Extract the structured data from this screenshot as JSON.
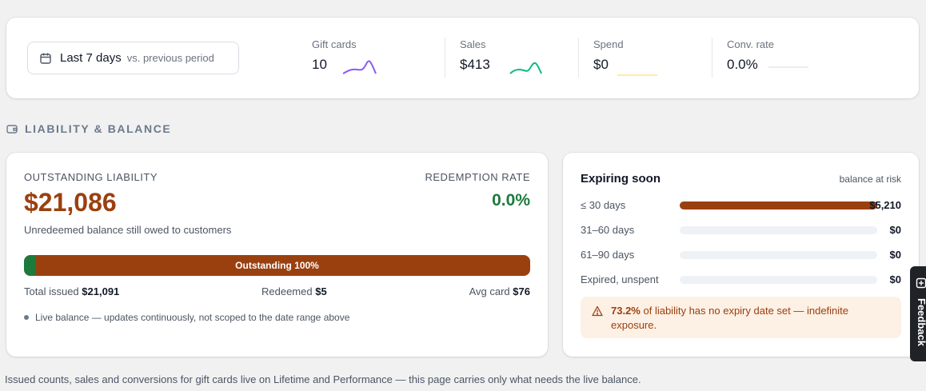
{
  "stats": {
    "date_range": {
      "label": "Last 7 days",
      "comparison": "vs. previous period"
    },
    "metrics": [
      {
        "label": "Gift cards",
        "value": "10",
        "spark_color": "#8b5cf6"
      },
      {
        "label": "Sales",
        "value": "$413",
        "spark_color": "#10b981"
      },
      {
        "label": "Spend",
        "value": "$0",
        "spark_color": "#fbbf24"
      },
      {
        "label": "Conv. rate",
        "value": "0.0%",
        "spark_color": "#d1d5db"
      }
    ]
  },
  "section": {
    "title": "LIABILITY & BALANCE"
  },
  "liability": {
    "label": "OUTSTANDING LIABILITY",
    "amount": "$21,086",
    "note": "Unredeemed balance still owed to customers",
    "redemption_label": "REDEMPTION RATE",
    "redemption_value": "0.0%",
    "bar": {
      "label": "Outstanding 100%",
      "redeemed_fraction": 0.024,
      "redeemed_color": "#1d7a3d",
      "outstanding_color": "#9a400f"
    },
    "total_issued_label": "Total issued",
    "total_issued": "$21,091",
    "redeemed_label": "Redeemed",
    "redeemed": "$5",
    "avg_card_label": "Avg card",
    "avg_card": "$76",
    "live_note": "Live balance — updates continuously, not scoped to the date range above"
  },
  "expiring": {
    "title": "Expiring soon",
    "subtitle": "balance at risk",
    "rows": [
      {
        "label": "≤ 30 days",
        "amount": "$5,210",
        "fill": 1.0
      },
      {
        "label": "31–60 days",
        "amount": "$0",
        "fill": 0
      },
      {
        "label": "61–90 days",
        "amount": "$0",
        "fill": 0
      },
      {
        "label": "Expired, unspent",
        "amount": "$0",
        "fill": 0
      }
    ],
    "warning_pct": "73.2%",
    "warning_text": " of liability has no expiry date set — indefinite exposure."
  },
  "footer": "Issued counts, sales and conversions for gift cards live on Lifetime and Performance — this page carries only what needs the live balance.",
  "feedback_label": "Feedback"
}
